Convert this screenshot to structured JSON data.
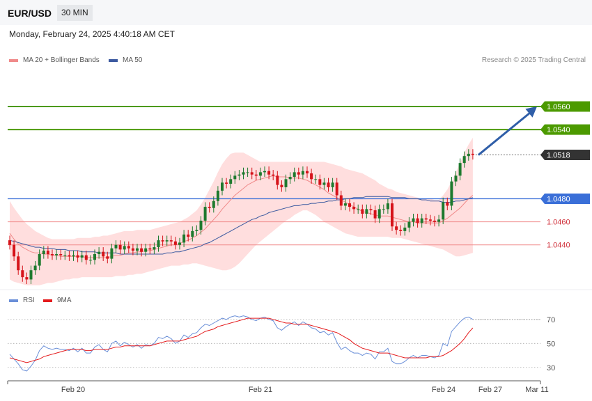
{
  "header": {
    "pair": "EUR/USD",
    "timeframe": "30 MIN"
  },
  "date": "Monday, February 24, 2025 4:40:18 AM CET",
  "legend": {
    "ma20": "MA 20 + Bollinger Bands",
    "ma50": "MA 50",
    "rsi": "RSI",
    "rsi_ma": "9MA"
  },
  "credit": "Research © 2025 Trading Central",
  "colors": {
    "resistance": "#4c9a00",
    "support": "#f08a8a",
    "pivot": "#3a6fd8",
    "last": "#333333",
    "bull": "#1e7a2e",
    "bear": "#d6131a",
    "band": "#ffdede",
    "ma20": "#f08a8a",
    "ma50": "#3c5aa0",
    "rsi": "#6a8fd8",
    "rsi_ma": "#e41a1c",
    "arrow": "#2f5ea8"
  },
  "chart_data": [
    {
      "type": "candlestick",
      "title": "EUR/USD 30 MIN",
      "ylim": [
        1.04,
        1.0595
      ],
      "x_ticks": [
        "Feb 20",
        "Feb 21",
        "Feb 24",
        "Feb 27",
        "Mar 11"
      ],
      "levels": [
        {
          "label": "1.0560",
          "value": 1.056,
          "kind": "resistance"
        },
        {
          "label": "1.0540",
          "value": 1.054,
          "kind": "resistance"
        },
        {
          "label": "1.0518",
          "value": 1.0518,
          "kind": "last"
        },
        {
          "label": "1.0480",
          "value": 1.048,
          "kind": "pivot"
        },
        {
          "label": "1.0460",
          "value": 1.046,
          "kind": "support"
        },
        {
          "label": "1.0440",
          "value": 1.044,
          "kind": "support"
        }
      ],
      "target_arrow": {
        "from": 1.0518,
        "to": 1.056
      },
      "close": [
        1.044,
        1.043,
        1.0418,
        1.0412,
        1.041,
        1.0418,
        1.0422,
        1.0432,
        1.0435,
        1.0432,
        1.0431,
        1.0432,
        1.0431,
        1.0431,
        1.043,
        1.0431,
        1.0429,
        1.0431,
        1.0427,
        1.0427,
        1.0432,
        1.0434,
        1.043,
        1.0428,
        1.0437,
        1.044,
        1.0436,
        1.0439,
        1.0437,
        1.0435,
        1.0437,
        1.0434,
        1.0437,
        1.0436,
        1.0438,
        1.0444,
        1.0443,
        1.0444,
        1.0443,
        1.044,
        1.0442,
        1.0449,
        1.0447,
        1.0452,
        1.0453,
        1.0461,
        1.0473,
        1.0472,
        1.0478,
        1.0487,
        1.0494,
        1.0493,
        1.0497,
        1.05,
        1.0501,
        1.0503,
        1.0503,
        1.0501,
        1.05,
        1.0503,
        1.0504,
        1.0501,
        1.05,
        1.0492,
        1.049,
        1.0497,
        1.0499,
        1.0503,
        1.0501,
        1.0504,
        1.0502,
        1.0497,
        1.0497,
        1.0492,
        1.0494,
        1.049,
        1.0494,
        1.0483,
        1.0474,
        1.0476,
        1.0473,
        1.0471,
        1.0471,
        1.0467,
        1.0471,
        1.047,
        1.0463,
        1.0471,
        1.0471,
        1.0476,
        1.0456,
        1.0453,
        1.0452,
        1.0455,
        1.046,
        1.0463,
        1.0459,
        1.0463,
        1.0462,
        1.0461,
        1.046,
        1.0462,
        1.0477,
        1.0474,
        1.0495,
        1.05,
        1.0511,
        1.0517,
        1.0519,
        1.0518
      ],
      "ma20": [
        1.045,
        1.0445,
        1.0441,
        1.0438,
        1.0436,
        1.0434,
        1.0433,
        1.0433,
        1.0432,
        1.0432,
        1.0431,
        1.0431,
        1.043,
        1.043,
        1.043,
        1.043,
        1.043,
        1.043,
        1.0429,
        1.0429,
        1.0429,
        1.0429,
        1.0429,
        1.0429,
        1.043,
        1.0431,
        1.0431,
        1.0432,
        1.0433,
        1.0433,
        1.0434,
        1.0434,
        1.0435,
        1.0435,
        1.0436,
        1.0437,
        1.0438,
        1.0439,
        1.044,
        1.044,
        1.0441,
        1.0443,
        1.0444,
        1.0446,
        1.0448,
        1.0451,
        1.0454,
        1.0458,
        1.0462,
        1.0466,
        1.0471,
        1.0475,
        1.0479,
        1.0483,
        1.0486,
        1.0489,
        1.0492,
        1.0494,
        1.0496,
        1.0497,
        1.0498,
        1.0499,
        1.05,
        1.0499,
        1.0499,
        1.0499,
        1.0498,
        1.0498,
        1.0498,
        1.0497,
        1.0496,
        1.0494,
        1.0492,
        1.049,
        1.0488,
        1.0485,
        1.0483,
        1.0481,
        1.0479,
        1.0477,
        1.0475,
        1.0473,
        1.0471,
        1.0469,
        1.0468,
        1.0467,
        1.0466,
        1.0465,
        1.0465,
        1.0465,
        1.0464,
        1.0463,
        1.0462,
        1.0461,
        1.046,
        1.046,
        1.0459,
        1.0459,
        1.0459,
        1.0459,
        1.0459,
        1.0459,
        1.0461,
        1.0463,
        1.0466,
        1.0469,
        1.0472,
        1.0476,
        1.048,
        1.0483
      ],
      "bb_upper": [
        1.0478,
        1.0472,
        1.0467,
        1.0462,
        1.0458,
        1.0455,
        1.0452,
        1.045,
        1.0448,
        1.0446,
        1.0445,
        1.0445,
        1.0445,
        1.0445,
        1.0445,
        1.0445,
        1.0446,
        1.0446,
        1.0446,
        1.0446,
        1.0447,
        1.0447,
        1.0448,
        1.0448,
        1.0449,
        1.045,
        1.0451,
        1.0452,
        1.0452,
        1.0452,
        1.0453,
        1.0453,
        1.0453,
        1.0453,
        1.0454,
        1.0455,
        1.0456,
        1.0457,
        1.0458,
        1.0459,
        1.046,
        1.0462,
        1.0464,
        1.0467,
        1.047,
        1.0475,
        1.0481,
        1.0488,
        1.0495,
        1.0503,
        1.051,
        1.0515,
        1.0519,
        1.052,
        1.052,
        1.052,
        1.0518,
        1.0516,
        1.0514,
        1.0512,
        1.0512,
        1.0512,
        1.0512,
        1.0512,
        1.0512,
        1.0512,
        1.0512,
        1.0512,
        1.0512,
        1.0512,
        1.0512,
        1.0512,
        1.0512,
        1.0512,
        1.0512,
        1.0511,
        1.051,
        1.0509,
        1.0508,
        1.0506,
        1.0505,
        1.0504,
        1.0503,
        1.0502,
        1.05,
        1.0498,
        1.0496,
        1.0493,
        1.0491,
        1.0489,
        1.0488,
        1.0486,
        1.0485,
        1.0484,
        1.0483,
        1.0482,
        1.0481,
        1.048,
        1.048,
        1.048,
        1.0479,
        1.0479,
        1.0483,
        1.0488,
        1.0495,
        1.0503,
        1.0511,
        1.052,
        1.0527,
        1.0533
      ],
      "bb_lower": [
        1.041,
        1.0408,
        1.0407,
        1.0406,
        1.0405,
        1.0405,
        1.0405,
        1.0405,
        1.0406,
        1.0407,
        1.0407,
        1.0408,
        1.0409,
        1.041,
        1.041,
        1.0411,
        1.0411,
        1.0412,
        1.0412,
        1.0412,
        1.0412,
        1.0412,
        1.0412,
        1.0412,
        1.0412,
        1.0413,
        1.0413,
        1.0413,
        1.0414,
        1.0414,
        1.0415,
        1.0415,
        1.0416,
        1.0417,
        1.0418,
        1.0419,
        1.042,
        1.0421,
        1.0422,
        1.0422,
        1.0422,
        1.0423,
        1.0423,
        1.0424,
        1.0424,
        1.0423,
        1.0422,
        1.0421,
        1.042,
        1.0419,
        1.0418,
        1.0418,
        1.0419,
        1.0421,
        1.0424,
        1.0428,
        1.0432,
        1.0436,
        1.044,
        1.0443,
        1.0446,
        1.0449,
        1.0452,
        1.0455,
        1.0458,
        1.0461,
        1.0463,
        1.0466,
        1.0468,
        1.047,
        1.047,
        1.0468,
        1.0466,
        1.0463,
        1.046,
        1.0458,
        1.0456,
        1.0454,
        1.0452,
        1.045,
        1.0449,
        1.0448,
        1.0447,
        1.0447,
        1.0447,
        1.0447,
        1.0447,
        1.0447,
        1.0447,
        1.0447,
        1.0446,
        1.0446,
        1.0446,
        1.0445,
        1.0444,
        1.0443,
        1.0442,
        1.0441,
        1.044,
        1.0439,
        1.0438,
        1.0437,
        1.0436,
        1.0434,
        1.0432,
        1.043,
        1.043,
        1.0431,
        1.0432,
        1.0433
      ],
      "ma50": [
        1.0444,
        1.0443,
        1.0442,
        1.0441,
        1.044,
        1.0439,
        1.0438,
        1.0438,
        1.0437,
        1.0437,
        1.0437,
        1.0436,
        1.0436,
        1.0436,
        1.0435,
        1.0435,
        1.0435,
        1.0434,
        1.0434,
        1.0434,
        1.0434,
        1.0433,
        1.0433,
        1.0433,
        1.0433,
        1.0433,
        1.0432,
        1.0432,
        1.0432,
        1.0432,
        1.0432,
        1.0432,
        1.0432,
        1.0432,
        1.0432,
        1.0432,
        1.0432,
        1.0433,
        1.0433,
        1.0434,
        1.0434,
        1.0435,
        1.0436,
        1.0437,
        1.0438,
        1.0439,
        1.0441,
        1.0442,
        1.0444,
        1.0446,
        1.0448,
        1.045,
        1.0452,
        1.0454,
        1.0456,
        1.0458,
        1.046,
        1.0462,
        1.0463,
        1.0465,
        1.0466,
        1.0468,
        1.0469,
        1.047,
        1.0471,
        1.0472,
        1.0473,
        1.0474,
        1.0474,
        1.0475,
        1.0475,
        1.0476,
        1.0476,
        1.0477,
        1.0477,
        1.0478,
        1.0478,
        1.0479,
        1.0479,
        1.048,
        1.048,
        1.0481,
        1.0481,
        1.0481,
        1.0482,
        1.0482,
        1.0482,
        1.0482,
        1.0482,
        1.0482,
        1.0481,
        1.0481,
        1.0481,
        1.0481,
        1.048,
        1.048,
        1.048,
        1.0479,
        1.0479,
        1.0478,
        1.0478,
        1.0478,
        1.0477,
        1.0477,
        1.0477,
        1.0478,
        1.0478,
        1.0479,
        1.048,
        1.0481
      ]
    },
    {
      "type": "line",
      "title": "RSI",
      "ylim": [
        20,
        85
      ],
      "y_ticks": [
        70,
        50,
        30
      ],
      "series": [
        {
          "name": "RSI",
          "values": [
            41,
            37,
            33,
            28,
            27,
            31,
            36,
            44,
            48,
            46,
            45,
            46,
            45,
            45,
            44,
            46,
            43,
            46,
            42,
            42,
            47,
            49,
            45,
            43,
            50,
            52,
            48,
            51,
            49,
            47,
            49,
            46,
            49,
            48,
            50,
            55,
            54,
            56,
            54,
            50,
            52,
            57,
            55,
            58,
            59,
            63,
            66,
            65,
            67,
            69,
            71,
            70,
            72,
            73,
            72,
            73,
            72,
            70,
            69,
            71,
            72,
            70,
            69,
            63,
            61,
            64,
            66,
            68,
            65,
            68,
            66,
            63,
            62,
            59,
            60,
            57,
            59,
            51,
            45,
            47,
            44,
            42,
            42,
            40,
            42,
            41,
            37,
            43,
            43,
            46,
            35,
            33,
            33,
            35,
            38,
            40,
            38,
            40,
            40,
            39,
            38,
            40,
            50,
            48,
            60,
            64,
            68,
            71,
            72,
            70
          ]
        },
        {
          "name": "9MA",
          "values": [
            38,
            37,
            36,
            35,
            34,
            35,
            36,
            37,
            39,
            40,
            41,
            42,
            43,
            44,
            45,
            45,
            45,
            45,
            44,
            44,
            45,
            45,
            45,
            45,
            46,
            47,
            47,
            48,
            48,
            48,
            48,
            48,
            48,
            48,
            49,
            50,
            51,
            52,
            52,
            52,
            52,
            53,
            54,
            55,
            56,
            58,
            60,
            61,
            62,
            64,
            65,
            66,
            67,
            68,
            69,
            70,
            71,
            71,
            71,
            71,
            71,
            71,
            70,
            69,
            68,
            67,
            67,
            66,
            66,
            66,
            66,
            65,
            64,
            63,
            62,
            61,
            60,
            59,
            57,
            55,
            53,
            50,
            48,
            46,
            45,
            44,
            43,
            42,
            42,
            42,
            41,
            40,
            39,
            38,
            38,
            38,
            38,
            38,
            38,
            39,
            39,
            39,
            40,
            42,
            44,
            47,
            50,
            54,
            59,
            63
          ]
        }
      ]
    }
  ]
}
